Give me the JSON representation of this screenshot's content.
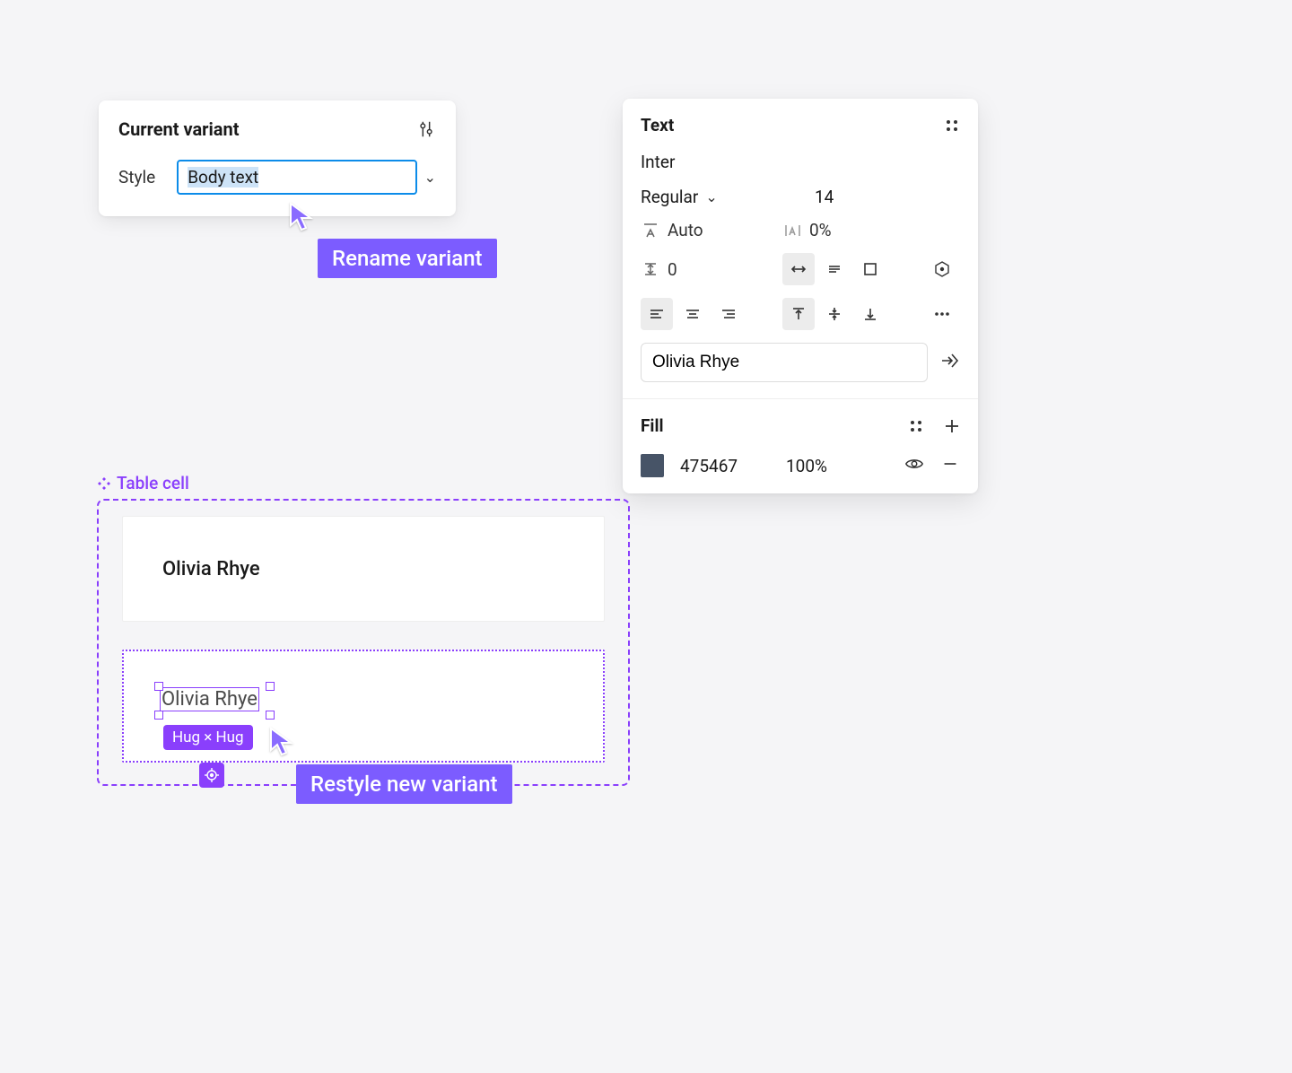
{
  "variant_panel": {
    "title": "Current variant",
    "prop_label": "Style",
    "prop_value": "Body text"
  },
  "annotations": {
    "rename": "Rename variant",
    "restyle": "Restyle new variant"
  },
  "text_panel": {
    "title": "Text",
    "font_family": "Inter",
    "font_weight": "Regular",
    "font_size": "14",
    "line_height": "Auto",
    "letter_spacing": "0%",
    "paragraph_spacing": "0",
    "content": "Olivia Rhye"
  },
  "fill_panel": {
    "title": "Fill",
    "hex": "475467",
    "opacity": "100%",
    "swatch_color": "#475467"
  },
  "component": {
    "label": "Table cell",
    "cell1_text": "Olivia Rhye",
    "cell2_text": "Olivia Rhye",
    "size_pill": "Hug × Hug"
  }
}
